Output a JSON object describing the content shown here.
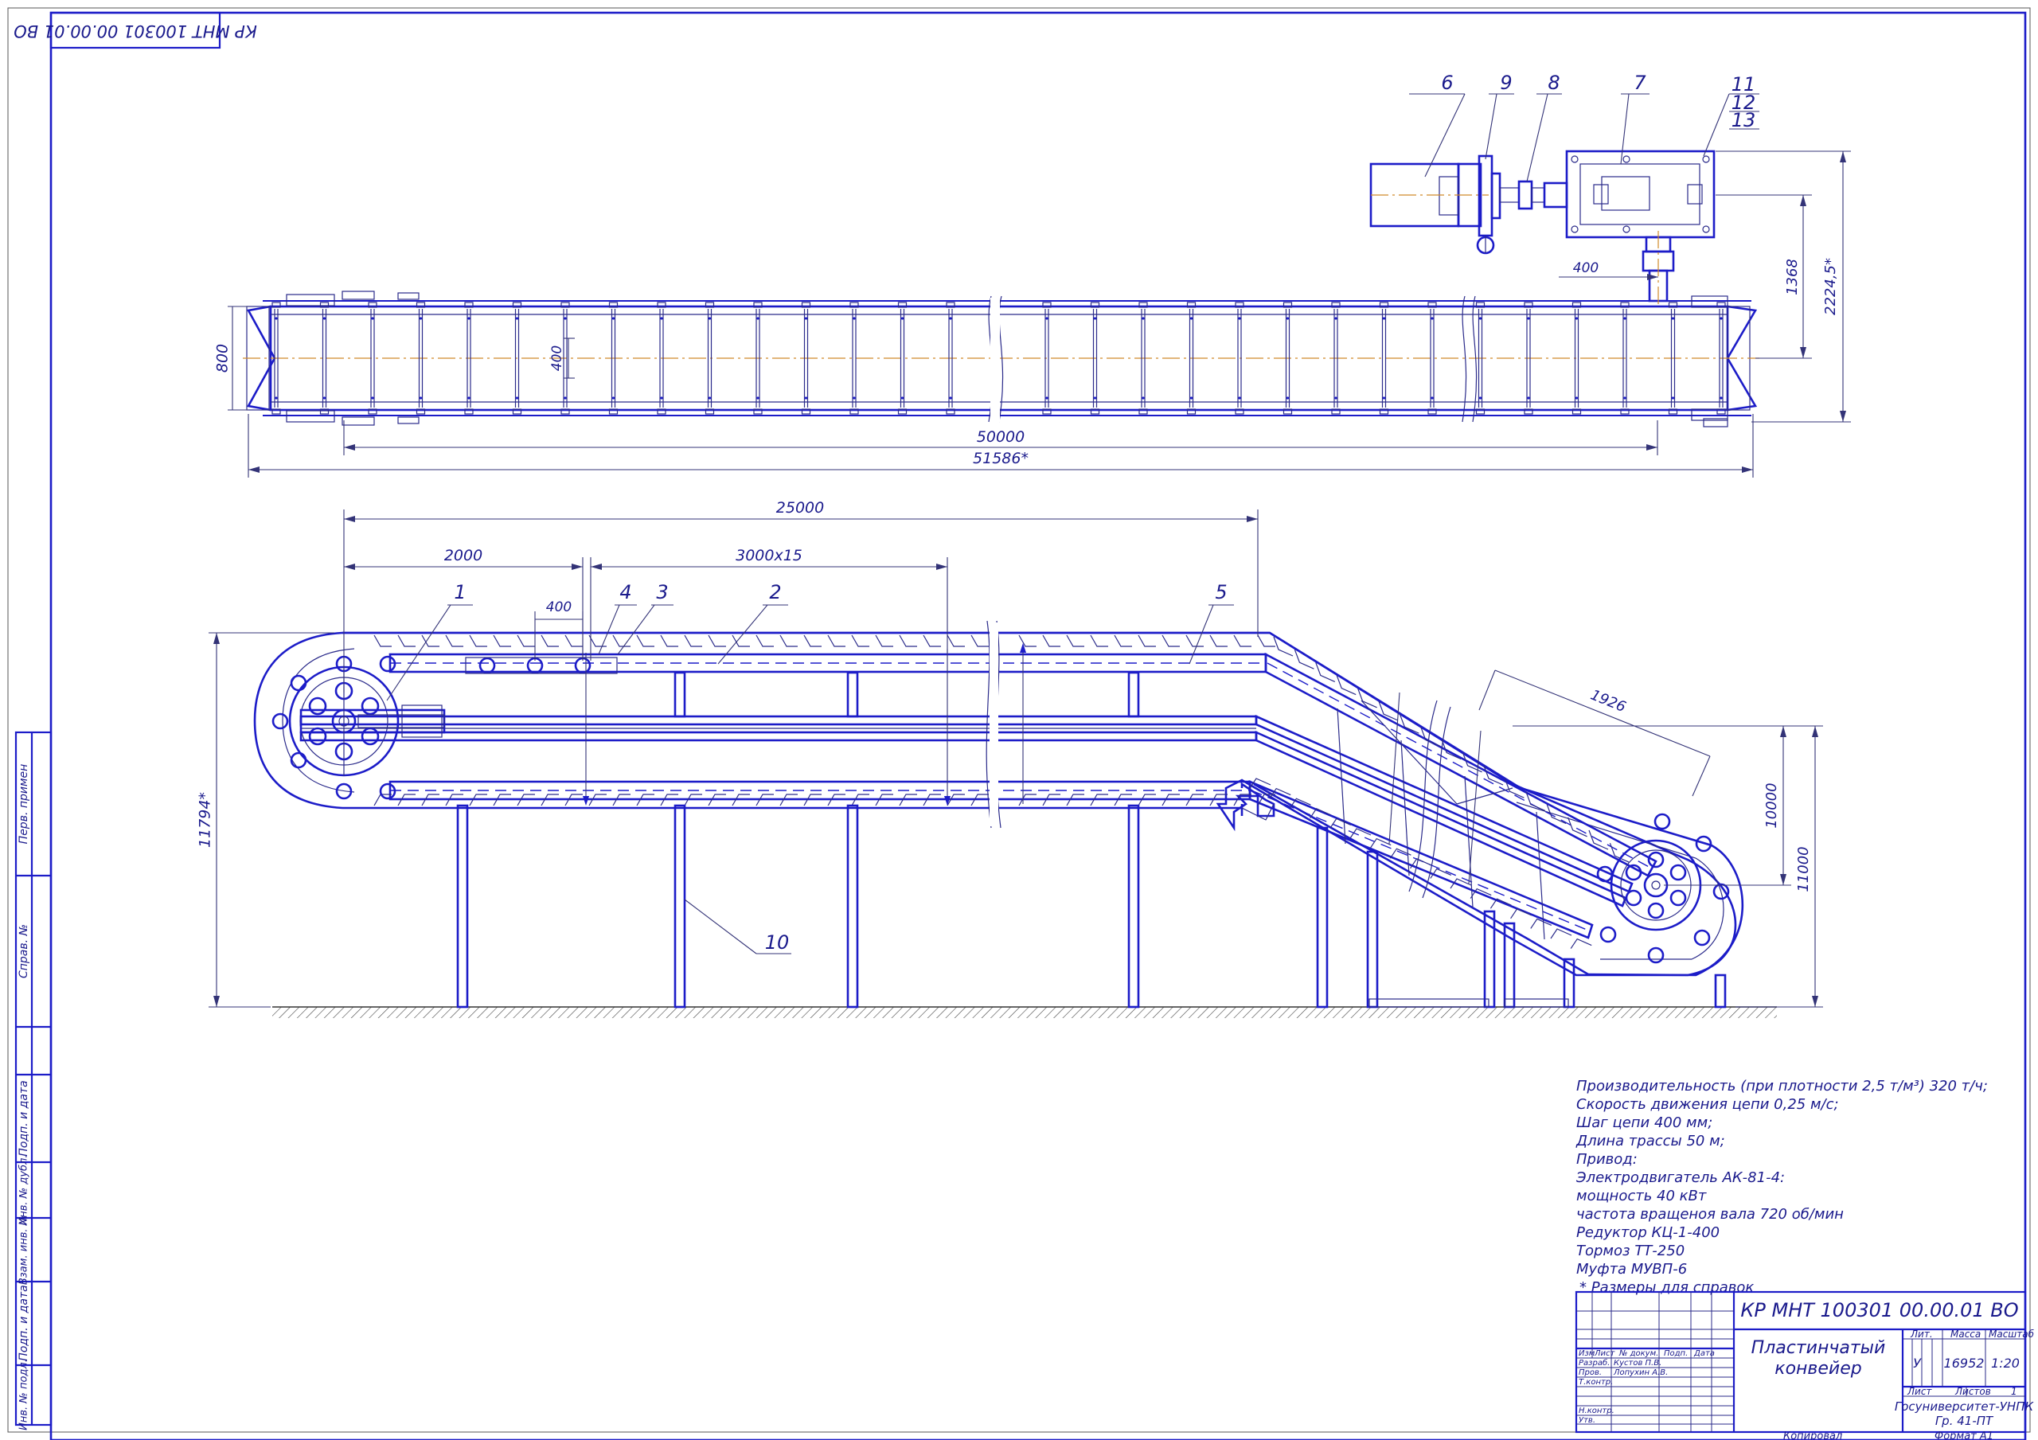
{
  "stamp_code_rotated": "КР МНТ 100301 00.00.01 ВО",
  "plan_view": {
    "dims": {
      "width_800": "800",
      "pitch_400": "400",
      "length_50000": "50000",
      "total_51586": "51586*",
      "drive_400": "400",
      "h_1368": "1368",
      "h_2224": "2224,5*"
    },
    "callouts": [
      "6",
      "9",
      "8",
      "7",
      "11",
      "12",
      "13"
    ]
  },
  "side_view": {
    "dims": {
      "d_25000": "25000",
      "d_2000": "2000",
      "d_3000x15": "3000x15",
      "d_400": "400",
      "d_1926": "1926",
      "h_11794": "11794*",
      "h_10000": "10000",
      "h_11000": "11000"
    },
    "callouts": [
      "1",
      "4",
      "3",
      "2",
      "5",
      "10"
    ]
  },
  "notes": [
    "Производительность (при плотности 2,5 т/м³) 320 т/ч;",
    "Скорость движения цепи 0,25 м/с;",
    "Шаг цепи 400 мм;",
    "Длина трассы 50 м;",
    "Привод:",
    "Электродвигатель АК-81-4:",
    "мощность 40 кВт",
    "частота вращеноя вала 720 об/мин",
    "Редуктор КЦ-1-400",
    "Тормоз ТТ-250",
    "Муфта МУВП-6",
    "* Размеры для справок"
  ],
  "side_strip": [
    "Перв. примен",
    "Справ. №",
    "Подп. и дата",
    "Инв. № дубл.",
    "Взам. инв. №",
    "Подп. и дата",
    "Инв. № подл."
  ],
  "title_block": {
    "code": "КР МНТ 100301 00.00.01 ВО",
    "name_line1": "Пластинчатый",
    "name_line2": "конвейер",
    "hdr_izm": "Изм",
    "hdr_list": "Лист",
    "hdr_ndoc": "№ докум.",
    "hdr_podp": "Подп.",
    "hdr_data": "Дата",
    "role_razrab": "Разраб.",
    "name_razrab": "Кустов П.В.",
    "role_prov": "Пров.",
    "name_prov": "Лопухин А.В.",
    "role_tkontr": "Т.контр.",
    "role_nkontr": "Н.контр.",
    "role_utv": "Утв.",
    "lit_label": "Лит.",
    "mass_label": "Масса",
    "scale_label": "Масштаб",
    "lit_value": "У",
    "mass_value": "16952",
    "scale_value": "1:20",
    "sheet_label": "Лист",
    "sheets_label": "Листов",
    "sheets_value": "1",
    "org_line1": "Госуниверситет-УНПК",
    "org_line2": "Гр. 41-ПТ",
    "copied": "Копировал",
    "format": "Формат   А1"
  }
}
